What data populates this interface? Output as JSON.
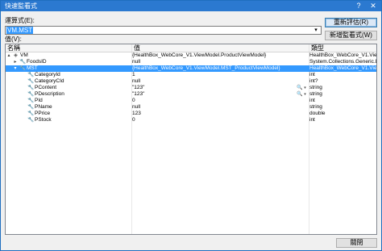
{
  "window": {
    "title": "快速監看式",
    "help": "?",
    "close": "✕"
  },
  "expression": {
    "label": "運算式(E):",
    "value": "VM.MST",
    "dropdown": "▾"
  },
  "buttons": {
    "reevaluate": "重新評估(R)",
    "add_watch": "新增監看式(W)",
    "close": "關閉"
  },
  "values_label": "值(V):",
  "columns": {
    "name": "名稱",
    "value": "值",
    "type": "類型"
  },
  "rows": [
    {
      "expand": "▴",
      "icon": "◈",
      "name": "VM",
      "value": "{HealthBox_WebCore_V1.ViewModel.ProductViewModel}",
      "type": "HealthBox_WebCore_V1.ViewM"
    },
    {
      "expand": "▸",
      "icon": "🔧",
      "name": "FoodsID",
      "value": "null",
      "type": "System.Collections.Generic.Li"
    },
    {
      "expand": "▾",
      "icon": "🔧",
      "name": "MST",
      "value": "{HealthBox_WebCore_V1.ViewModel.MST_ProductViewModel}",
      "type": "HealthBox_WebCore_V1.ViewM"
    },
    {
      "icon": "🔧",
      "name": "CategoryId",
      "value": "1",
      "type": "int"
    },
    {
      "icon": "🔧",
      "name": "CategoryCId",
      "value": "null",
      "type": "int?"
    },
    {
      "icon": "🔧",
      "name": "PContent",
      "value": "\"123\"",
      "type": "string",
      "magnifier": "🔍",
      "mag_dd": "▾"
    },
    {
      "icon": "🔧",
      "name": "PDescription",
      "value": "\"123\"",
      "type": "string",
      "magnifier": "🔍",
      "mag_dd": "▾"
    },
    {
      "icon": "🔧",
      "name": "PId",
      "value": "0",
      "type": "int"
    },
    {
      "icon": "🔧",
      "name": "PName",
      "value": "null",
      "type": "string"
    },
    {
      "icon": "🔧",
      "name": "PPrice",
      "value": "123",
      "type": "double"
    },
    {
      "icon": "🔧",
      "name": "PStock",
      "value": "0",
      "type": "int"
    }
  ],
  "selected_row": 2,
  "colors": {
    "title_bar": "#2b79d0",
    "selection": "#3399ff",
    "background": "#f0f0f0"
  }
}
